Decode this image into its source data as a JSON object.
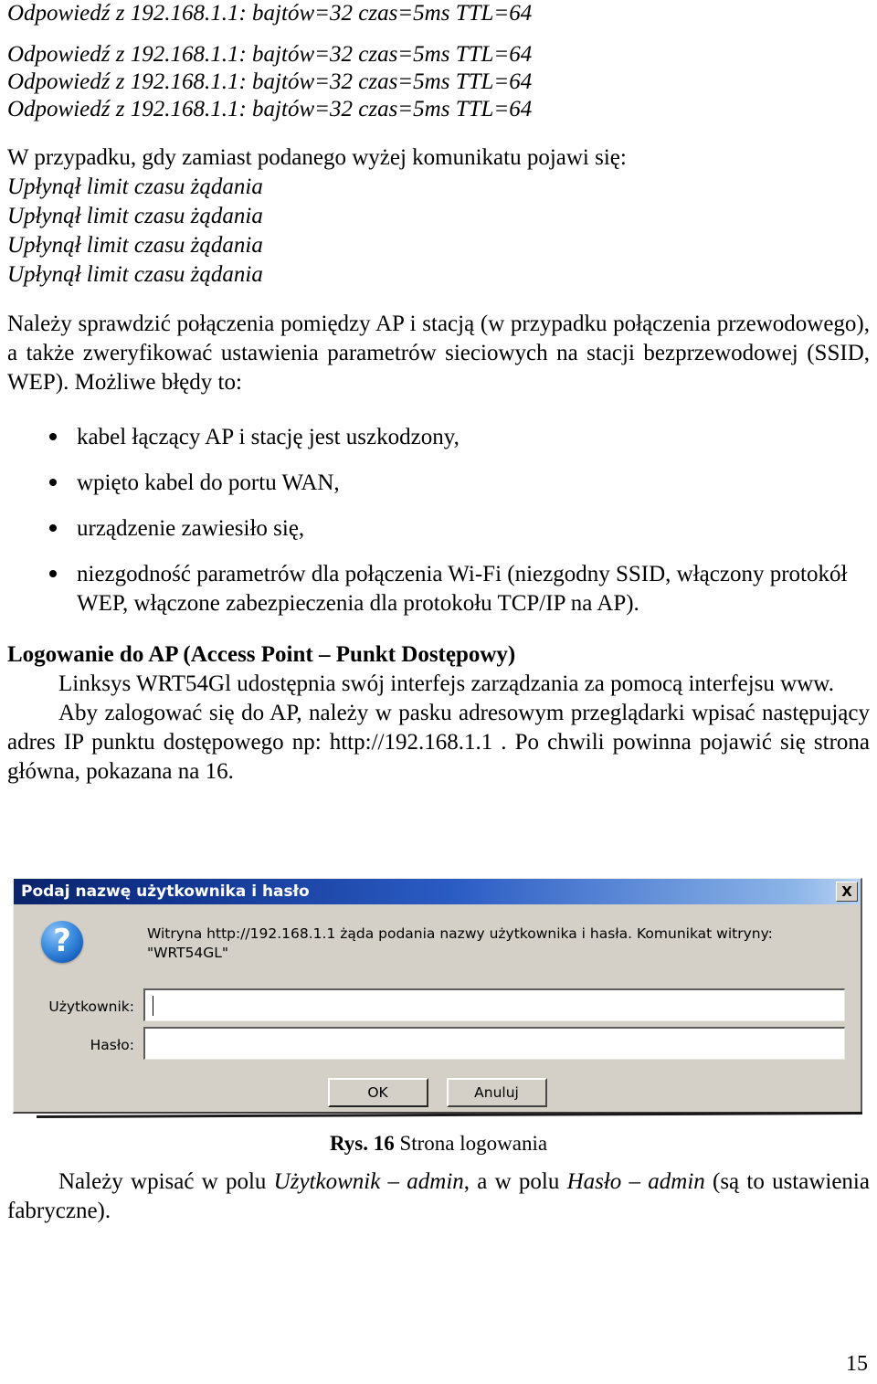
{
  "ping_replies_first": "Odpowiedź z 192.168.1.1: bajtów=32 czas=5ms TTL=64",
  "ping_replies": [
    "Odpowiedź z 192.168.1.1: bajtów=32 czas=5ms TTL=64",
    "Odpowiedź z 192.168.1.1: bajtów=32 czas=5ms TTL=64",
    "Odpowiedź z 192.168.1.1: bajtów=32 czas=5ms TTL=64"
  ],
  "intro_line": "W przypadku, gdy zamiast podanego wyżej komunikatu pojawi się:",
  "timeouts": [
    "Upłynął limit czasu żądania",
    "Upłynął limit czasu żądania",
    "Upłynął limit czasu żądania",
    "Upłynął limit czasu żądania"
  ],
  "check_paragraph": "Należy sprawdzić połączenia pomiędzy AP i stacją (w przypadku połączenia przewodowego), a także zweryfikować ustawienia parametrów sieciowych na stacji bezprzewodowej (SSID, WEP). Możliwe błędy to:",
  "errors": [
    "kabel łączący AP i stację jest uszkodzony,",
    "wpięto kabel do portu WAN,",
    "urządzenie zawiesiło się,",
    "niezgodność parametrów dla połączenia Wi-Fi (niezgodny SSID, włączony protokół WEP, włączone zabezpieczenia dla protokołu TCP/IP na AP)."
  ],
  "login_heading": "Logowanie do AP (Access Point – Punkt Dostępowy)",
  "login_p1": "Linksys WRT54Gl udostępnia swój interfejs zarządzania za pomocą interfejsu www.",
  "login_p2": "Aby zalogować się do AP, należy w pasku adresowym przeglądarki wpisać następujący adres IP punktu dostępowego np: http://192.168.1.1 . Po chwili powinna pojawić się strona główna, pokazana na 16.",
  "dialog": {
    "title": "Podaj nazwę użytkownika i hasło",
    "close_label": "X",
    "icon": "question-icon",
    "message_line1": "Witryna http://192.168.1.1 żąda podania nazwy użytkownika i hasła. Komunikat witryny:",
    "message_line2": "\"WRT54GL\"",
    "user_label": "Użytkownik:",
    "user_value": "",
    "password_label": "Hasło:",
    "password_value": "",
    "ok_label": "OK",
    "cancel_label": "Anuluj",
    "colors": {
      "titlebar_start": "#0b246a",
      "titlebar_end": "#b9d3f2",
      "face": "#d4d0c8",
      "icon_blue": "#1763c0"
    }
  },
  "figure_caption_label": "Rys. 16",
  "figure_caption_text": " Strona logowania",
  "after_figure": {
    "lead": "Należy wpisać w polu ",
    "field1": "Użytkownik – admin",
    "mid": ", a w polu ",
    "field2": "Hasło – admin",
    "tail": " (są to ustawienia fabryczne)."
  },
  "page_number": "15"
}
